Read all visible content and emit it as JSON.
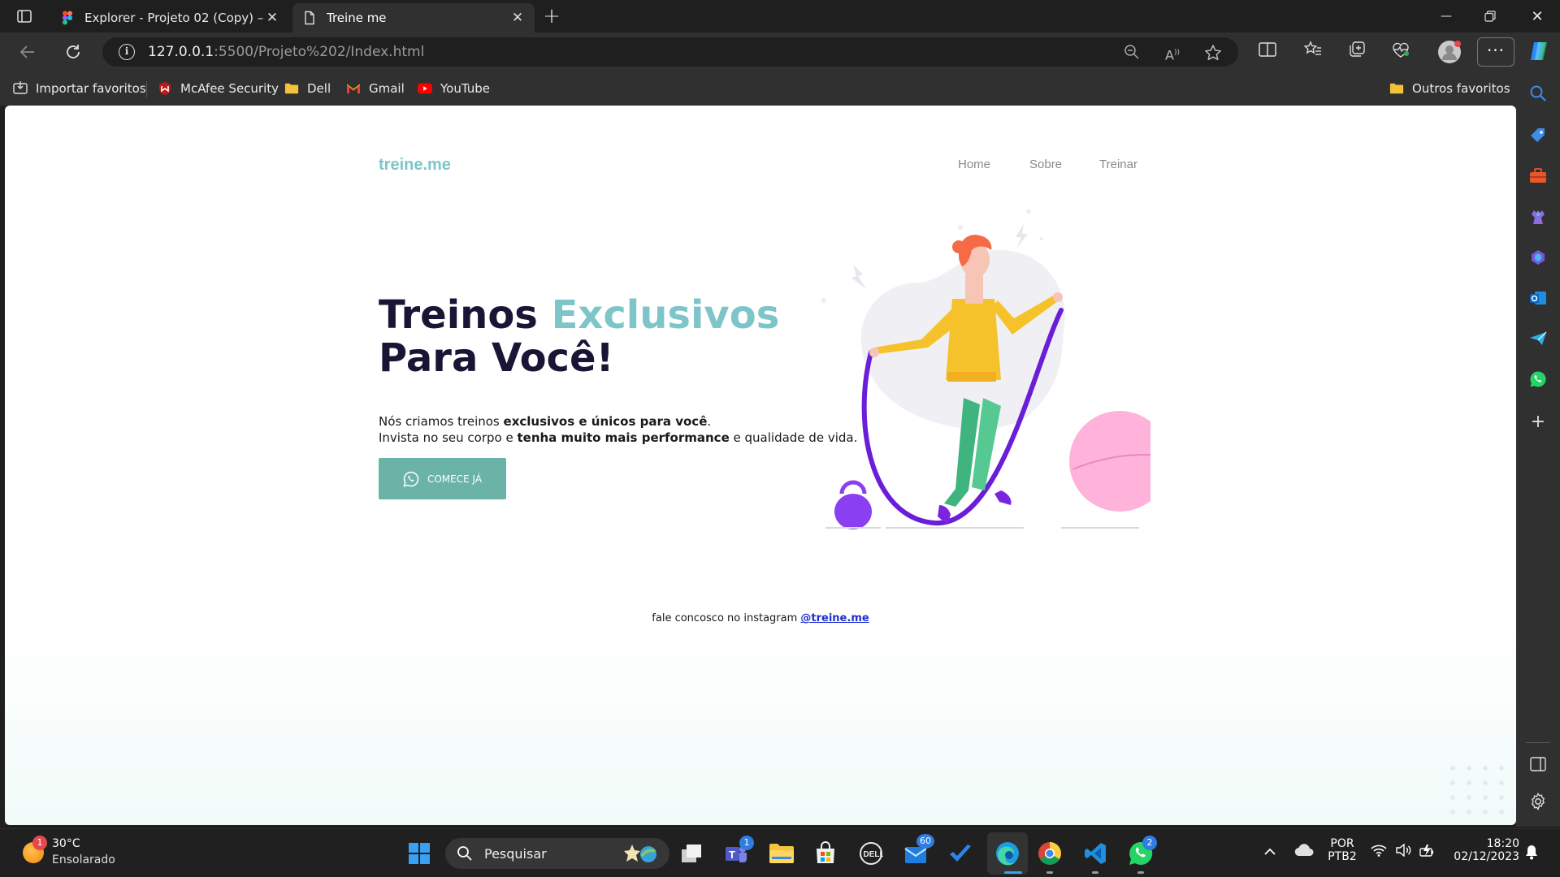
{
  "tabs": [
    {
      "title": "Explorer - Projeto 02 (Copy) – Fig",
      "favicon": "figma-icon"
    },
    {
      "title": "Treine me",
      "favicon": "page-icon"
    }
  ],
  "address_bar": {
    "url_host": "127.0.0.1",
    "url_rest": ":5500/Projeto%202/Index.html"
  },
  "bookmarks": [
    {
      "label": "Importar favoritos",
      "icon": "import-icon"
    },
    {
      "label": "McAfee Security",
      "icon": "mcafee-icon"
    },
    {
      "label": "Dell",
      "icon": "folder-icon"
    },
    {
      "label": "Gmail",
      "icon": "gmail-icon"
    },
    {
      "label": "YouTube",
      "icon": "youtube-icon"
    },
    {
      "label": "Outros favoritos",
      "icon": "folder-icon"
    }
  ],
  "page": {
    "brand": "treine.me",
    "nav": [
      "Home",
      "Sobre",
      "Treinar"
    ],
    "hero": {
      "title_part1": "Treinos ",
      "title_accent": "Exclusivos",
      "title_line2": "Para Você!",
      "line1_a": "Nós criamos treinos ",
      "line1_b": "exclusivos e únicos para você",
      "line1_c": ".",
      "line2_a": "Invista no seu corpo e ",
      "line2_b": "tenha muito mais performance",
      "line2_c": " e qualidade de vida.",
      "cta": "COMECE JÁ"
    },
    "footer": {
      "text": "fale concosco no instagram ",
      "link": "@treine.me"
    },
    "colors": {
      "accent": "#7ec5c9",
      "button": "#6bb3a7",
      "heading": "#1a1535"
    }
  },
  "taskbar": {
    "weather": {
      "badge": "1",
      "temp": "30°C",
      "condition": "Ensolarado"
    },
    "search_placeholder": "Pesquisar",
    "badges": {
      "teams": "1",
      "mail": "60",
      "whatsapp": "2"
    },
    "language": {
      "lang": "POR",
      "layout": "PTB2"
    },
    "clock": {
      "time": "18:20",
      "date": "02/12/2023"
    }
  }
}
